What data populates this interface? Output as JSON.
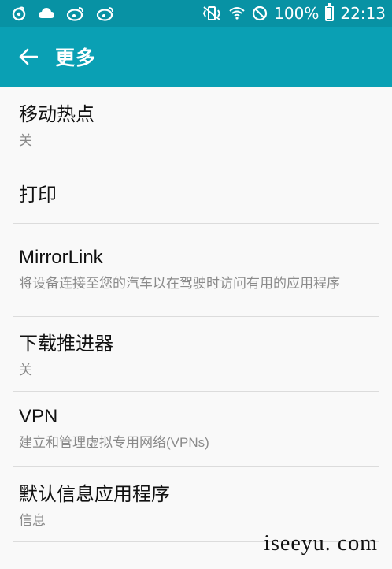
{
  "status_bar": {
    "left_icons": [
      "app-icon-1",
      "cloud-icon",
      "weibo-icon",
      "weibo-icon"
    ],
    "battery_percent": "100%",
    "time": "22:13"
  },
  "app_bar": {
    "title": "更多"
  },
  "items": [
    {
      "title": "移动热点",
      "subtitle": "关"
    },
    {
      "title": "打印",
      "subtitle": ""
    },
    {
      "title": "MirrorLink",
      "subtitle": "将设备连接至您的汽车以在驾驶时访问有用的应用程序"
    },
    {
      "title": "下载推进器",
      "subtitle": "关"
    },
    {
      "title": "VPN",
      "subtitle": "建立和管理虚拟专用网络(VPNs)"
    },
    {
      "title": "默认信息应用程序",
      "subtitle": "信息"
    }
  ],
  "watermark": "iseeyu. com",
  "colors": {
    "status_bar": "#0892a4",
    "app_bar": "#0aa0b4",
    "background": "#f9f9f9"
  }
}
